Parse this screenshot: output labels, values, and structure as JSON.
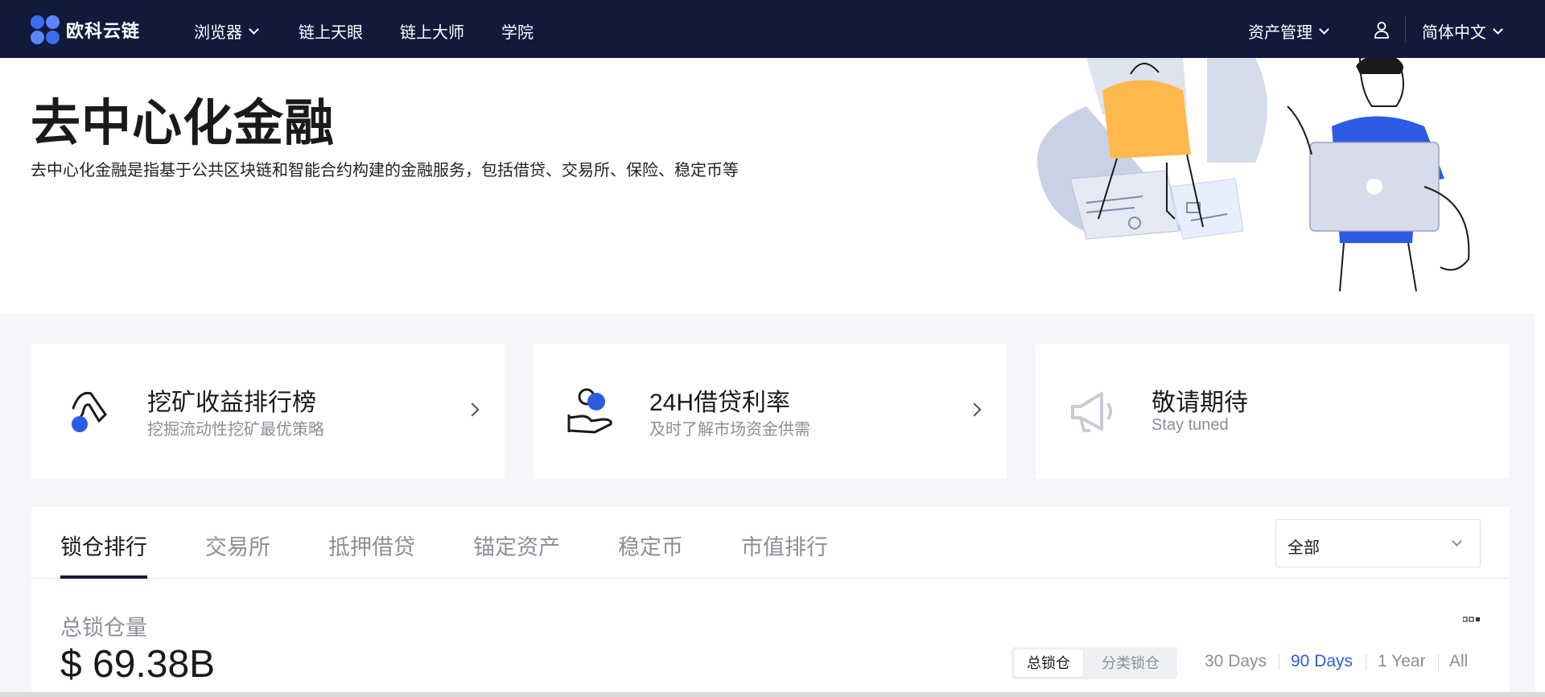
{
  "brand": {
    "name": "欧科云链"
  },
  "nav": {
    "items": [
      {
        "label": "浏览器",
        "dropdown": true
      },
      {
        "label": "链上天眼",
        "dropdown": false
      },
      {
        "label": "链上大师",
        "dropdown": false
      },
      {
        "label": "学院",
        "dropdown": false
      }
    ],
    "asset_management": "资产管理",
    "language": "简体中文"
  },
  "hero": {
    "title": "去中心化金融",
    "description": "去中心化金融是指基于公共区块链和智能合约构建的金融服务，包括借贷、交易所、保险、稳定币等"
  },
  "cards": [
    {
      "title": "挖矿收益排行榜",
      "subtitle": "挖掘流动性挖矿最优策略",
      "icon": "mining-pick-icon",
      "arrow": true
    },
    {
      "title": "24H借贷利率",
      "subtitle": "及时了解市场资金供需",
      "icon": "hand-coins-icon",
      "arrow": true
    },
    {
      "title": "敬请期待",
      "subtitle": "Stay tuned",
      "icon": "megaphone-icon",
      "arrow": false
    }
  ],
  "tabs": {
    "items": [
      "锁仓排行",
      "交易所",
      "抵押借贷",
      "锚定资产",
      "稳定币",
      "市值排行"
    ],
    "active": "锁仓排行"
  },
  "filter": {
    "selected": "全部"
  },
  "tvl": {
    "label": "总锁仓量",
    "value": "$ 69.38B",
    "toggle": {
      "on": "总锁仓",
      "off": "分类锁仓"
    },
    "ranges": [
      "30 Days",
      "90 Days",
      "1 Year",
      "All"
    ],
    "active_range": "90 Days"
  },
  "colors": {
    "nav_bg": "#111a3a",
    "accent": "#2d5be3",
    "section_bg": "#f4f5f8",
    "illus_yellow": "#ffb84d",
    "illus_blue": "#2d5be3"
  }
}
